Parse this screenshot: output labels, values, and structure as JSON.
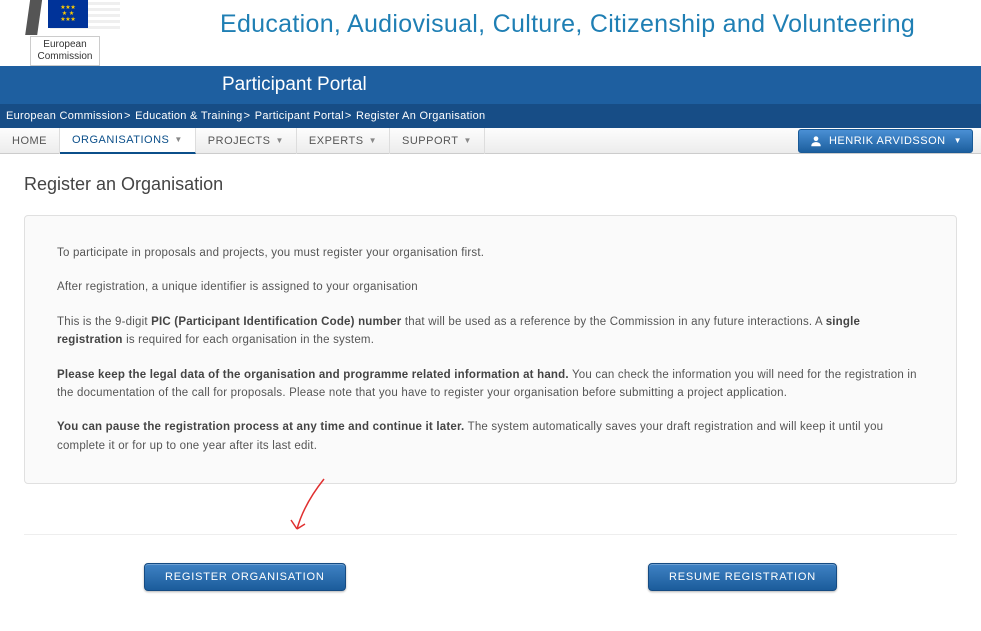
{
  "header": {
    "ec_label_line1": "European",
    "ec_label_line2": "Commission",
    "main_title": "Education, Audiovisual, Culture, Citizenship and Volunteering",
    "portal_name": "Participant Portal"
  },
  "breadcrumb": {
    "items": [
      {
        "label": "European Commission"
      },
      {
        "label": "Education & Training"
      },
      {
        "label": "Participant Portal"
      },
      {
        "label": "Register An Organisation"
      }
    ]
  },
  "nav": {
    "items": [
      {
        "label": "HOME",
        "active": false,
        "dropdown": false
      },
      {
        "label": "ORGANISATIONS",
        "active": true,
        "dropdown": true
      },
      {
        "label": "PROJECTS",
        "active": false,
        "dropdown": true
      },
      {
        "label": "EXPERTS",
        "active": false,
        "dropdown": true
      },
      {
        "label": "SUPPORT",
        "active": false,
        "dropdown": true
      }
    ],
    "user_name": "HENRIK ARVIDSSON"
  },
  "page": {
    "title": "Register an Organisation",
    "paragraphs": {
      "p1": "To participate in proposals and projects, you must register your organisation first.",
      "p2": "After registration, a unique identifier is assigned to your organisation",
      "p3a": "This is the 9-digit ",
      "p3b": "PIC (Participant Identification Code) number",
      "p3c": " that will be used as a reference by the Commission in any future interactions. A ",
      "p3d": "single registration",
      "p3e": " is required for each organisation in the system.",
      "p4a": "Please keep the legal data of the organisation and programme related information at hand.",
      "p4b": " You can check the information you will need for the registration in the documentation of the call for proposals. Please note that you have to register your organisation before submitting a project application.",
      "p5a": "You can pause the registration process at any time and continue it later.",
      "p5b": " The system automatically saves your draft registration and will keep it until you complete it or for up to one year after its last edit."
    },
    "buttons": {
      "register": "REGISTER ORGANISATION",
      "resume": "RESUME REGISTRATION"
    }
  }
}
